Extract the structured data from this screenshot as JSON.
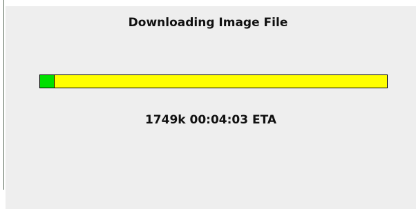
{
  "dialog": {
    "title": "Downloading Image File",
    "status_text": "1749k 00:04:03 ETA",
    "progress_fraction": 0.04
  },
  "colors": {
    "background": "#eeeeee",
    "bar_remaining": "#ffff00",
    "bar_done": "#00e000",
    "text": "#111111"
  }
}
